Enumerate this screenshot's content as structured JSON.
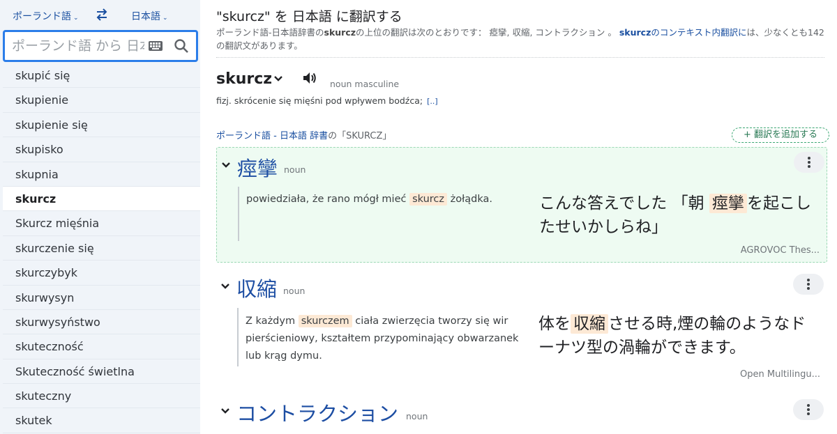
{
  "sidebar": {
    "source_lang": "ポーランド語",
    "target_lang": "日本語",
    "search_placeholder": "ポーランド語 から 日本語",
    "words": [
      {
        "label": "skupić się",
        "active": false
      },
      {
        "label": "skupienie",
        "active": false
      },
      {
        "label": "skupienie się",
        "active": false
      },
      {
        "label": "skupisko",
        "active": false
      },
      {
        "label": "skupnia",
        "active": false
      },
      {
        "label": "skurcz",
        "active": true
      },
      {
        "label": "Skurcz mięśnia",
        "active": false
      },
      {
        "label": "skurczenie się",
        "active": false
      },
      {
        "label": "skurczybyk",
        "active": false
      },
      {
        "label": "skurwysyn",
        "active": false
      },
      {
        "label": "skurwysyństwo",
        "active": false
      },
      {
        "label": "skuteczność",
        "active": false
      },
      {
        "label": "Skuteczność świetlna",
        "active": false
      },
      {
        "label": "skuteczny",
        "active": false
      },
      {
        "label": "skutek",
        "active": false
      }
    ]
  },
  "header": {
    "title": "\"skurcz\" を 日本語 に翻訳する",
    "summary_1": "ポーランド語-日本語辞書の",
    "summary_word": "skurcz",
    "summary_2": "の上位の翻訳は次のとおりです： 瘂攣, 収縮, コントラクション 。 ",
    "summary_link_word": "skurcz",
    "summary_link": "のコンテキスト内翻訳に",
    "summary_3": "は、少なくとも142の翻訳文があります。"
  },
  "headword": {
    "word": "skurcz",
    "pos": "noun masculine",
    "definition": "fizj. skrócenie się mięśni pod wpływem bodźca;",
    "more": "[..]"
  },
  "dict": {
    "heading_link": "ポーランド語 - 日本語 辞書",
    "heading_plain": "の「SKURCZ」",
    "add_button": "+ 翻訳を追加する"
  },
  "entries": [
    {
      "term": "痙攣",
      "pos": "noun",
      "ex_src_before": "powiedziała, że rano mógł mieć ",
      "ex_src_hl": "skurcz",
      "ex_src_after": " żołądka.",
      "ex_tgt_before": "こんな答えでした 「朝 ",
      "ex_tgt_hl": "痙攣",
      "ex_tgt_after": "を起こしたせいかしらね」",
      "source": "AGROVOC Thes..."
    },
    {
      "term": "収縮",
      "pos": "noun",
      "ex_src_before": "Z każdym ",
      "ex_src_hl": "skurczem",
      "ex_src_after": " ciała zwierzęcia tworzy się wir pierścieniowy, kształtem przypominający obwarzanek lub krąg dymu.",
      "ex_tgt_before": "体を",
      "ex_tgt_hl": "収縮",
      "ex_tgt_after": "させる時,煙の輪のようなドーナツ型の渦輪ができます。",
      "source": "Open Multilingu..."
    },
    {
      "term": "コントラクション",
      "pos": "noun"
    }
  ],
  "colors": {
    "accent": "#1a4fa0",
    "focus": "#2b7de9",
    "highlight": "#fde9d5",
    "highlight_panel": "#eefbf2"
  }
}
